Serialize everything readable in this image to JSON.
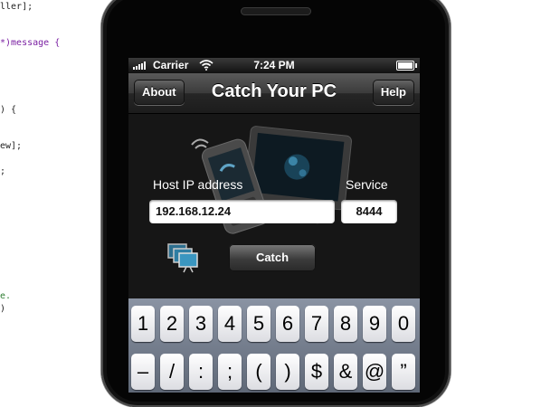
{
  "code_editor": {
    "lines": [
      {
        "text": "ller];",
        "tone": "normal"
      },
      {
        "text": "*)message {",
        "tone": "keyword"
      },
      {
        "text": ") {",
        "tone": "normal"
      },
      {
        "text": "ew];",
        "tone": "normal"
      },
      {
        "text": ";",
        "tone": "normal"
      },
      {
        "text": "e.",
        "tone": "green"
      },
      {
        "text": ")",
        "tone": "normal"
      }
    ]
  },
  "status_bar": {
    "carrier": "Carrier",
    "time": "7:24 PM",
    "battery_level": 1.0
  },
  "nav": {
    "left_button": "About",
    "title": "Catch Your PC",
    "right_button": "Help"
  },
  "form": {
    "host_label": "Host IP address",
    "host_value": "192.168.12.24",
    "service_label": "Service",
    "service_value": "8444",
    "catch_button": "Catch"
  },
  "keyboard": {
    "row1": [
      "1",
      "2",
      "3",
      "4",
      "5",
      "6",
      "7",
      "8",
      "9",
      "0"
    ],
    "row2": [
      "–",
      "/",
      ":",
      ";",
      "(",
      ")",
      "$",
      "&",
      "@",
      "”"
    ]
  },
  "icons": {
    "art": "phone-and-monitor-illustration",
    "monitors": "multiple-monitors-icon"
  },
  "colors": {
    "nav_bar": "#2a2a2a",
    "keyboard": "#6f7888",
    "content_bg": "#161616"
  }
}
